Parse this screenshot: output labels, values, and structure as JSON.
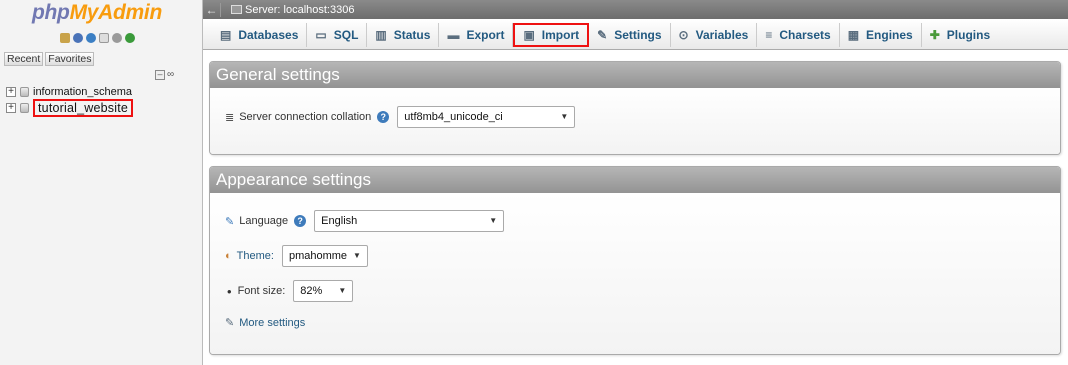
{
  "navigation": {
    "logo_php": "php",
    "logo_myadmin": "MyAdmin",
    "recent_label": "Recent",
    "favorites_label": "Favorites",
    "databases": [
      {
        "name": "information_schema"
      },
      {
        "name": "tutorial_website"
      }
    ]
  },
  "serverbar": {
    "back_arrow": "←",
    "server_label": "Server: localhost:3306"
  },
  "tabs": [
    {
      "label": "Databases",
      "icon": "database-icon"
    },
    {
      "label": "SQL",
      "icon": "sql-icon"
    },
    {
      "label": "Status",
      "icon": "status-icon"
    },
    {
      "label": "Export",
      "icon": "export-icon"
    },
    {
      "label": "Import",
      "icon": "import-icon"
    },
    {
      "label": "Settings",
      "icon": "wrench-icon"
    },
    {
      "label": "Variables",
      "icon": "variables-icon"
    },
    {
      "label": "Charsets",
      "icon": "charsets-icon"
    },
    {
      "label": "Engines",
      "icon": "engines-icon"
    },
    {
      "label": "Plugins",
      "icon": "puzzle-icon"
    }
  ],
  "general_settings": {
    "title": "General settings",
    "collation_label": "Server connection collation",
    "collation_value": "utf8mb4_unicode_ci"
  },
  "appearance_settings": {
    "title": "Appearance settings",
    "language_label": "Language",
    "language_value": "English",
    "theme_label": "Theme:",
    "theme_value": "pmahomme",
    "font_size_label": "Font size:",
    "font_size_value": "82%",
    "more_settings_label": "More settings"
  },
  "colors": {
    "link_blue": "#235a81",
    "highlight_red": "#e11111",
    "legend_gray": "#a3a3a3"
  }
}
